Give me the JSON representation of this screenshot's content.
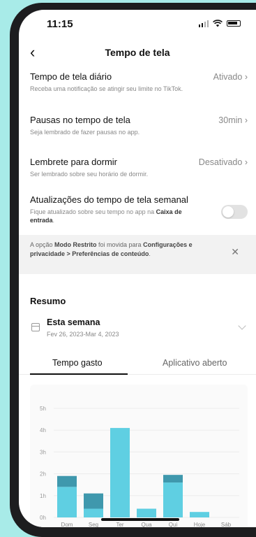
{
  "status_bar": {
    "time": "11:15"
  },
  "nav": {
    "title": "Tempo de tela"
  },
  "settings": [
    {
      "label": "Tempo de tela diário",
      "value": "Ativado",
      "desc": "Receba uma notificação se atingir seu limite no TikTok."
    },
    {
      "label": "Pausas no tempo de tela",
      "value": "30min",
      "desc": "Seja lembrado de fazer pausas no app."
    },
    {
      "label": "Lembrete para dormir",
      "value": "Desativado",
      "desc": "Ser lembrado sobre seu horário de dormir."
    },
    {
      "label": "Atualizações do tempo de tela semanal",
      "desc_prefix": "Fique atualizado sobre seu tempo no app na ",
      "desc_bold": "Caixa de entrada",
      "desc_suffix": ".",
      "toggle_on": false
    }
  ],
  "notice": {
    "prefix": "A opção ",
    "bold1": "Modo Restrito",
    "middle": " foi movida para ",
    "bold2": "Configurações e privacidade > Preferências de conteúdo",
    "suffix": "."
  },
  "summary": {
    "title": "Resumo",
    "week_title": "Esta semana",
    "week_range": "Fev 26, 2023-Mar 4, 2023"
  },
  "tabs": [
    {
      "label": "Tempo gasto",
      "active": true
    },
    {
      "label": "Aplicativo aberto",
      "active": false
    }
  ],
  "colors": {
    "bar_light": "#5fcfe2",
    "bar_dark": "#3f98ad",
    "accent": "#111111"
  },
  "chart_data": {
    "type": "bar",
    "categories": [
      "Dom",
      "Seg",
      "Ter",
      "Qua",
      "Qui",
      "Hoje",
      "Sáb"
    ],
    "y_ticks": [
      "0h",
      "1h",
      "2h",
      "3h",
      "4h",
      "5h"
    ],
    "ylim": [
      0,
      5
    ],
    "series": [
      {
        "values": [
          1.4,
          0.4,
          4.1,
          0.4,
          1.6,
          0.25,
          0
        ]
      },
      {
        "values": [
          0.5,
          0.7,
          0,
          0,
          0.35,
          0,
          0
        ]
      }
    ],
    "grid": true
  }
}
